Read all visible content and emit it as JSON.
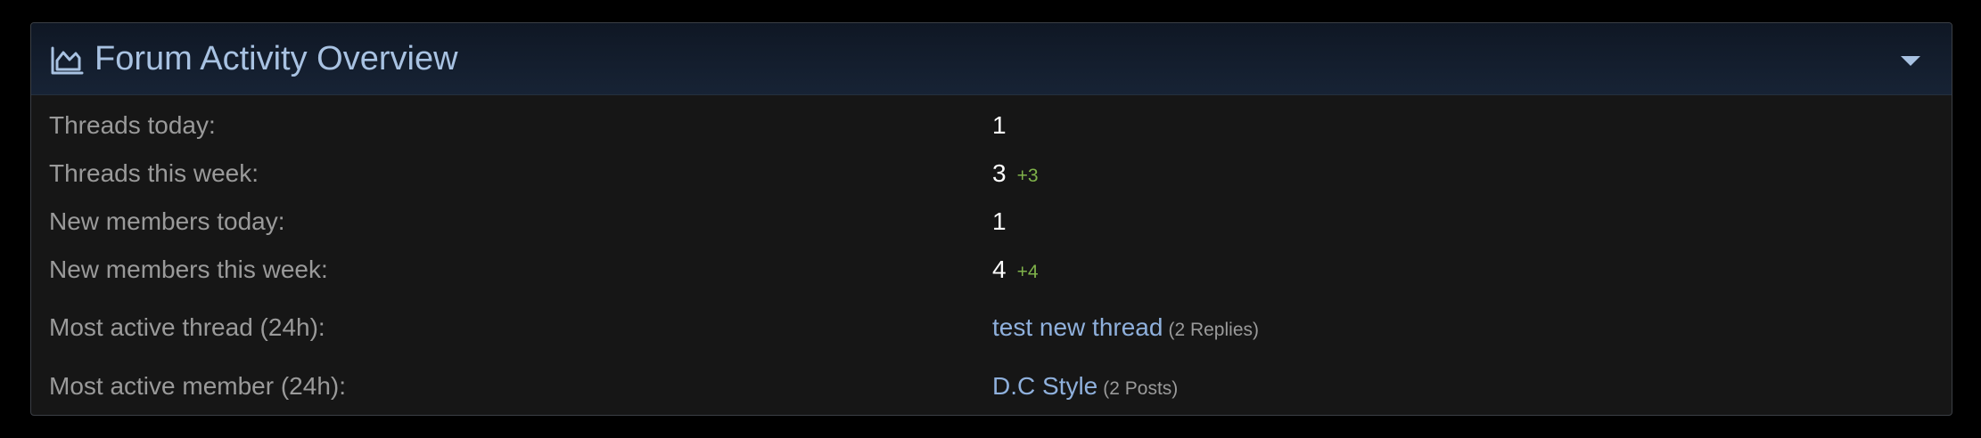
{
  "widget": {
    "title": "Forum Activity Overview",
    "icon": "area-chart-icon",
    "toggle_icon": "caret-down-icon"
  },
  "stats": {
    "threads_today": {
      "label": "Threads today:",
      "value": "1"
    },
    "threads_week": {
      "label": "Threads this week:",
      "value": "3",
      "delta": "+3"
    },
    "members_today": {
      "label": "New members today:",
      "value": "1"
    },
    "members_week": {
      "label": "New members this week:",
      "value": "4",
      "delta": "+4"
    },
    "active_thread": {
      "label": "Most active thread (24h):",
      "link": "test new thread",
      "detail": "(2 Replies)"
    },
    "active_member": {
      "label": "Most active member (24h):",
      "link": "D.C Style",
      "detail": "(2 Posts)"
    }
  },
  "colors": {
    "header_title": "#a8c2e2",
    "link": "#8fb0dc",
    "delta": "#7fb24a",
    "label": "#9a9a9a",
    "value": "#ffffff"
  }
}
